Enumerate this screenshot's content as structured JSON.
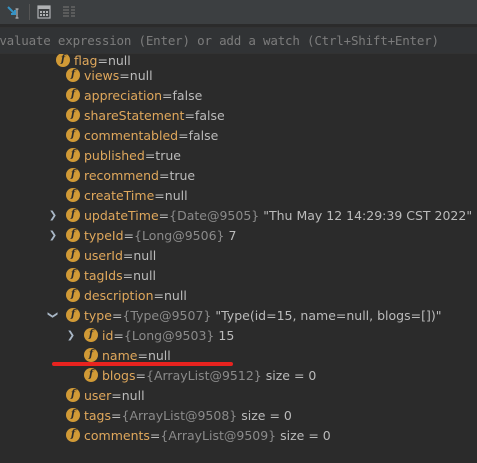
{
  "toolbar": {
    "icons": [
      "step-cursor-icon",
      "calculator-icon",
      "layout-settings-icon"
    ]
  },
  "eval": {
    "placeholder": "Evaluate expression (Enter) or add a watch (Ctrl+Shift+Enter)"
  },
  "colors": {
    "field_name": "#e0a85c",
    "badge": "#d19a36",
    "underline": "#e8231f",
    "background": "#2b2b2b"
  },
  "variables": [
    {
      "name": "flag",
      "eq": " = ",
      "ref": "",
      "value": "null"
    },
    {
      "name": "views",
      "eq": " = ",
      "ref": "",
      "value": "null"
    },
    {
      "name": "appreciation",
      "eq": " = ",
      "ref": "",
      "value": "false"
    },
    {
      "name": "shareStatement",
      "eq": " = ",
      "ref": "",
      "value": "false"
    },
    {
      "name": "commentabled",
      "eq": " = ",
      "ref": "",
      "value": "false"
    },
    {
      "name": "published",
      "eq": " = ",
      "ref": "",
      "value": "true"
    },
    {
      "name": "recommend",
      "eq": " = ",
      "ref": "",
      "value": "true"
    },
    {
      "name": "createTime",
      "eq": " = ",
      "ref": "",
      "value": "null"
    },
    {
      "name": "updateTime",
      "eq": " = ",
      "ref": "{Date@9505}",
      "value": "\"Thu May 12 14:29:39 CST 2022\""
    },
    {
      "name": "typeId",
      "eq": " = ",
      "ref": "{Long@9506}",
      "value": "7"
    },
    {
      "name": "userId",
      "eq": " = ",
      "ref": "",
      "value": "null"
    },
    {
      "name": "tagIds",
      "eq": " = ",
      "ref": "",
      "value": "null"
    },
    {
      "name": "description",
      "eq": " = ",
      "ref": "",
      "value": "null"
    },
    {
      "name": "type",
      "eq": " = ",
      "ref": "{Type@9507}",
      "value": "\"Type(id=15, name=null, blogs=[])\""
    },
    {
      "name": "id",
      "eq": " = ",
      "ref": "{Long@9503}",
      "value": "15"
    },
    {
      "name": "name",
      "eq": " = ",
      "ref": "",
      "value": "null"
    },
    {
      "name": "blogs",
      "eq": " = ",
      "ref": "{ArrayList@9512}",
      "value": " size = 0"
    },
    {
      "name": "user",
      "eq": " = ",
      "ref": "",
      "value": "null"
    },
    {
      "name": "tags",
      "eq": " = ",
      "ref": "{ArrayList@9508}",
      "value": " size = 0"
    },
    {
      "name": "comments",
      "eq": " = ",
      "ref": "{ArrayList@9509}",
      "value": " size = 0"
    }
  ]
}
